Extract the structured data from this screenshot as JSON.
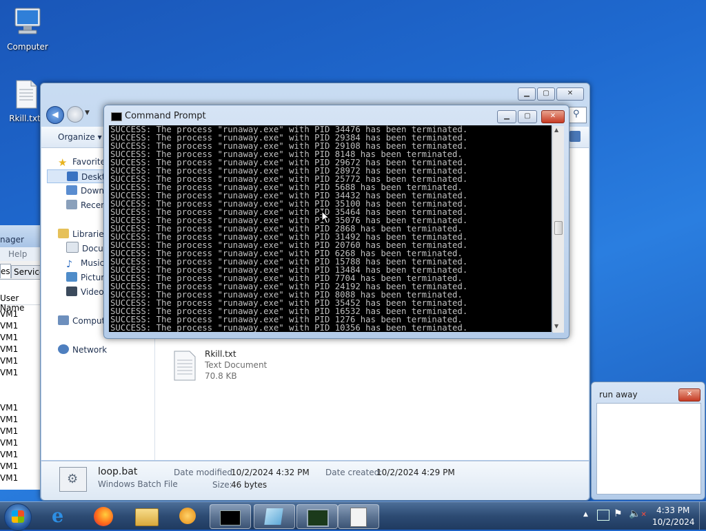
{
  "desktop": {
    "icons": [
      {
        "label": "Computer",
        "icon": "computer-icon"
      },
      {
        "label": "Rkill.txt",
        "icon": "text-file-icon"
      }
    ]
  },
  "explorer": {
    "toolbar": {
      "organize": "Organize ▾"
    },
    "nav": {
      "favorites": "Favorites",
      "desktop": "Deskto",
      "downloads": "Downl",
      "recent": "Recent",
      "libraries": "Libraries",
      "documents": "Docun",
      "music": "Music",
      "pictures": "Picture",
      "videos": "Videos",
      "computer": "Comput",
      "network": "Network"
    },
    "file": {
      "name": "Rkill.txt",
      "type": "Text Document",
      "size": "70.8 KB"
    },
    "details": {
      "name": "loop.bat",
      "type": "Windows Batch File",
      "modified_label": "Date modified:",
      "modified_value": "10/2/2024 4:32 PM",
      "created_label": "Date created:",
      "created_value": "10/2/2024 4:29 PM",
      "size_label": "Size:",
      "size_value": "46 bytes"
    }
  },
  "task_manager": {
    "title_fragment": "nager",
    "menu_help": "Help",
    "tab_left": "es",
    "tab_services": "Services",
    "column_user": "User Name",
    "rows_top": [
      "VM1",
      "VM1",
      "VM1",
      "VM1",
      "VM1",
      "VM1"
    ],
    "rows_bottom": [
      "VM1",
      "VM1",
      "VM1",
      "VM1",
      "VM1",
      "VM1",
      "VM1"
    ]
  },
  "cmd": {
    "title": "Command Prompt",
    "lines": [
      "SUCCESS: The process \"runaway.exe\" with PID 34476 has been terminated.",
      "SUCCESS: The process \"runaway.exe\" with PID 29384 has been terminated.",
      "SUCCESS: The process \"runaway.exe\" with PID 29108 has been terminated.",
      "SUCCESS: The process \"runaway.exe\" with PID 8148 has been terminated.",
      "SUCCESS: The process \"runaway.exe\" with PID 29672 has been terminated.",
      "SUCCESS: The process \"runaway.exe\" with PID 28972 has been terminated.",
      "SUCCESS: The process \"runaway.exe\" with PID 25772 has been terminated.",
      "SUCCESS: The process \"runaway.exe\" with PID 5688 has been terminated.",
      "SUCCESS: The process \"runaway.exe\" with PID 34432 has been terminated.",
      "SUCCESS: The process \"runaway.exe\" with PID 35100 has been terminated.",
      "SUCCESS: The process \"runaway.exe\" with PID 35464 has been terminated.",
      "SUCCESS: The process \"runaway.exe\" with PID 35076 has been terminated.",
      "SUCCESS: The process \"runaway.exe\" with PID 2868 has been terminated.",
      "SUCCESS: The process \"runaway.exe\" with PID 31492 has been terminated.",
      "SUCCESS: The process \"runaway.exe\" with PID 20760 has been terminated.",
      "SUCCESS: The process \"runaway.exe\" with PID 6268 has been terminated.",
      "SUCCESS: The process \"runaway.exe\" with PID 15788 has been terminated.",
      "SUCCESS: The process \"runaway.exe\" with PID 13484 has been terminated.",
      "SUCCESS: The process \"runaway.exe\" with PID 7704 has been terminated.",
      "SUCCESS: The process \"runaway.exe\" with PID 24192 has been terminated.",
      "SUCCESS: The process \"runaway.exe\" with PID 8088 has been terminated.",
      "SUCCESS: The process \"runaway.exe\" with PID 35452 has been terminated.",
      "SUCCESS: The process \"runaway.exe\" with PID 16532 has been terminated.",
      "SUCCESS: The process \"runaway.exe\" with PID 1276 has been terminated.",
      "SUCCESS: The process \"runaway.exe\" with PID 10356 has been terminated."
    ]
  },
  "dialog": {
    "title": "run away"
  },
  "taskbar": {
    "items": [
      "start-orb-icon",
      "internet-explorer-icon",
      "firefox-icon",
      "windows-explorer-icon",
      "media-player-icon",
      "command-prompt-icon",
      "notepad-icon",
      "task-manager-icon",
      "batch-file-icon"
    ],
    "clock_time": "4:33 PM",
    "clock_date": "10/2/2024"
  },
  "colors": {
    "accent": "#1f6ad0",
    "console_bg": "#000000",
    "console_fg": "#c0c0c0",
    "close_red": "#c63b24"
  }
}
